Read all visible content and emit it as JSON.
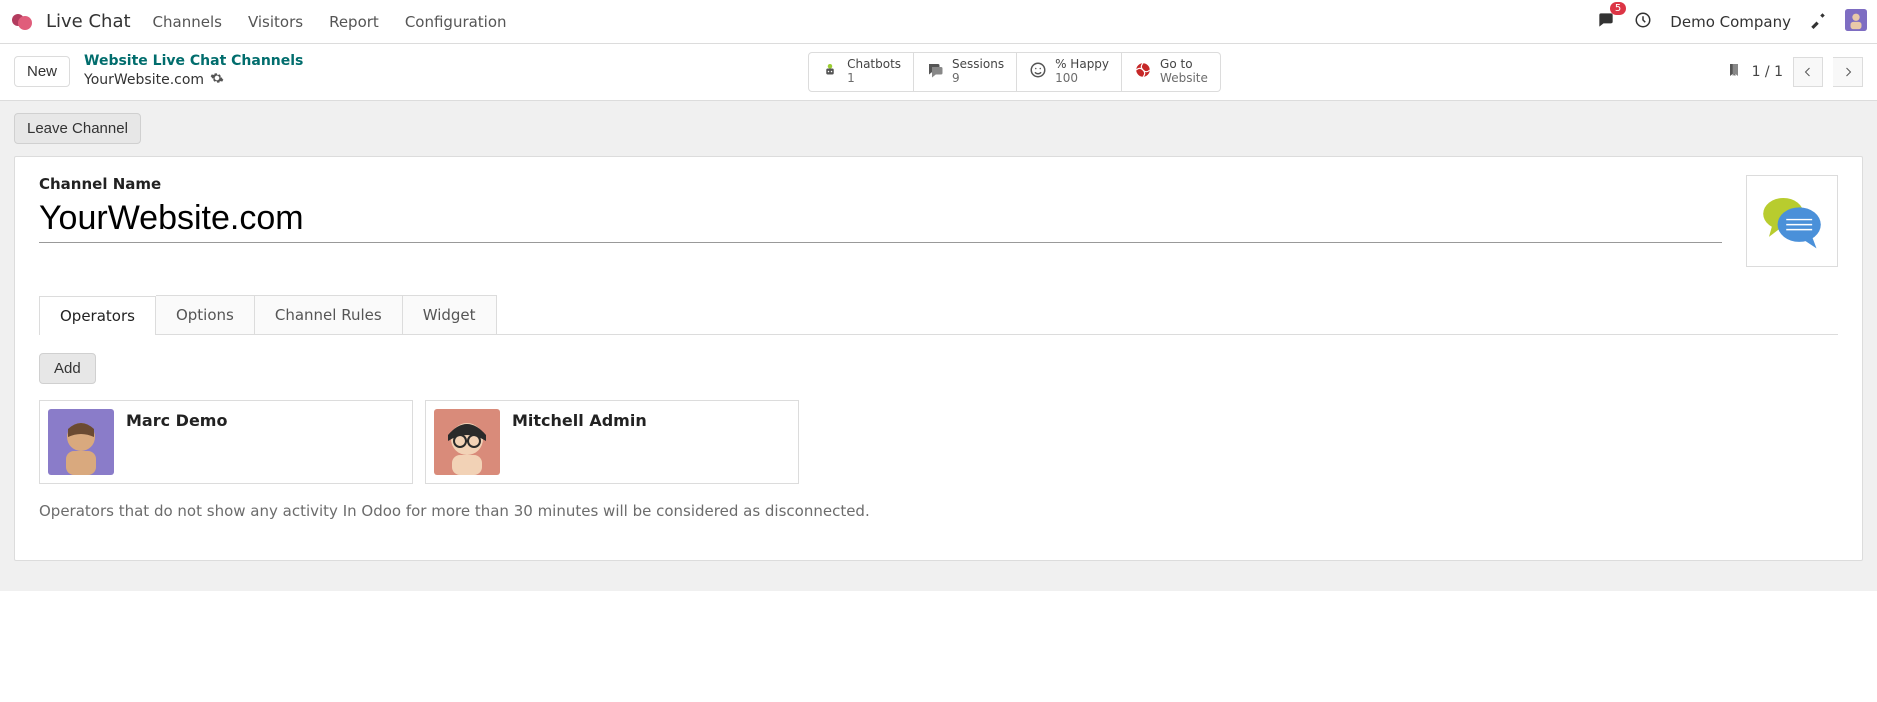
{
  "nav": {
    "brand": "Live Chat",
    "items": [
      "Channels",
      "Visitors",
      "Report",
      "Configuration"
    ],
    "message_count": "5",
    "company": "Demo Company"
  },
  "breadcrumb": {
    "new_label": "New",
    "parent": "Website Live Chat Channels",
    "current": "YourWebsite.com"
  },
  "stats": [
    {
      "label": "Chatbots",
      "value": "1"
    },
    {
      "label": "Sessions",
      "value": "9"
    },
    {
      "label": "% Happy",
      "value": "100"
    },
    {
      "label": "Go to",
      "value": "Website"
    }
  ],
  "pager": {
    "text": "1 / 1"
  },
  "actions": {
    "leave": "Leave Channel",
    "add": "Add"
  },
  "form": {
    "channel_name_label": "Channel Name",
    "channel_name_value": "YourWebsite.com"
  },
  "tabs": [
    "Operators",
    "Options",
    "Channel Rules",
    "Widget"
  ],
  "operators": [
    {
      "name": "Marc Demo"
    },
    {
      "name": "Mitchell Admin"
    }
  ],
  "hint": "Operators that do not show any activity In Odoo for more than 30 minutes will be considered as disconnected."
}
